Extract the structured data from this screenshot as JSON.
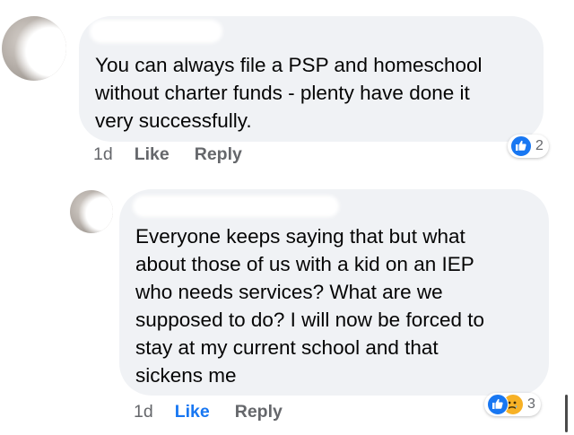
{
  "comments": [
    {
      "text": "You can always file a PSP and homeschool\nwithout charter funds - plenty have done it\nvery successfully.",
      "time": "1d",
      "like_label": "Like",
      "reply_label": "Reply",
      "reactions": [
        "like-icon"
      ],
      "reaction_count": "2",
      "liked_by_viewer": false
    },
    {
      "text": "Everyone keeps saying that but what\nabout those of us with a kid on an IEP\nwho needs services? What are we\nsupposed to do? I will now be forced to\nstay at my current school and that\nsickens me",
      "time": "1d",
      "like_label": "Like",
      "reply_label": "Reply",
      "reactions": [
        "like-icon",
        "sad-icon"
      ],
      "reaction_count": "3",
      "liked_by_viewer": true
    }
  ],
  "colors": {
    "bubble": "#f0f2f5",
    "meta_text": "#65676b",
    "like_active": "#1877f2",
    "like_reaction": "#1877f2",
    "sad_reaction": "#f7b125"
  }
}
